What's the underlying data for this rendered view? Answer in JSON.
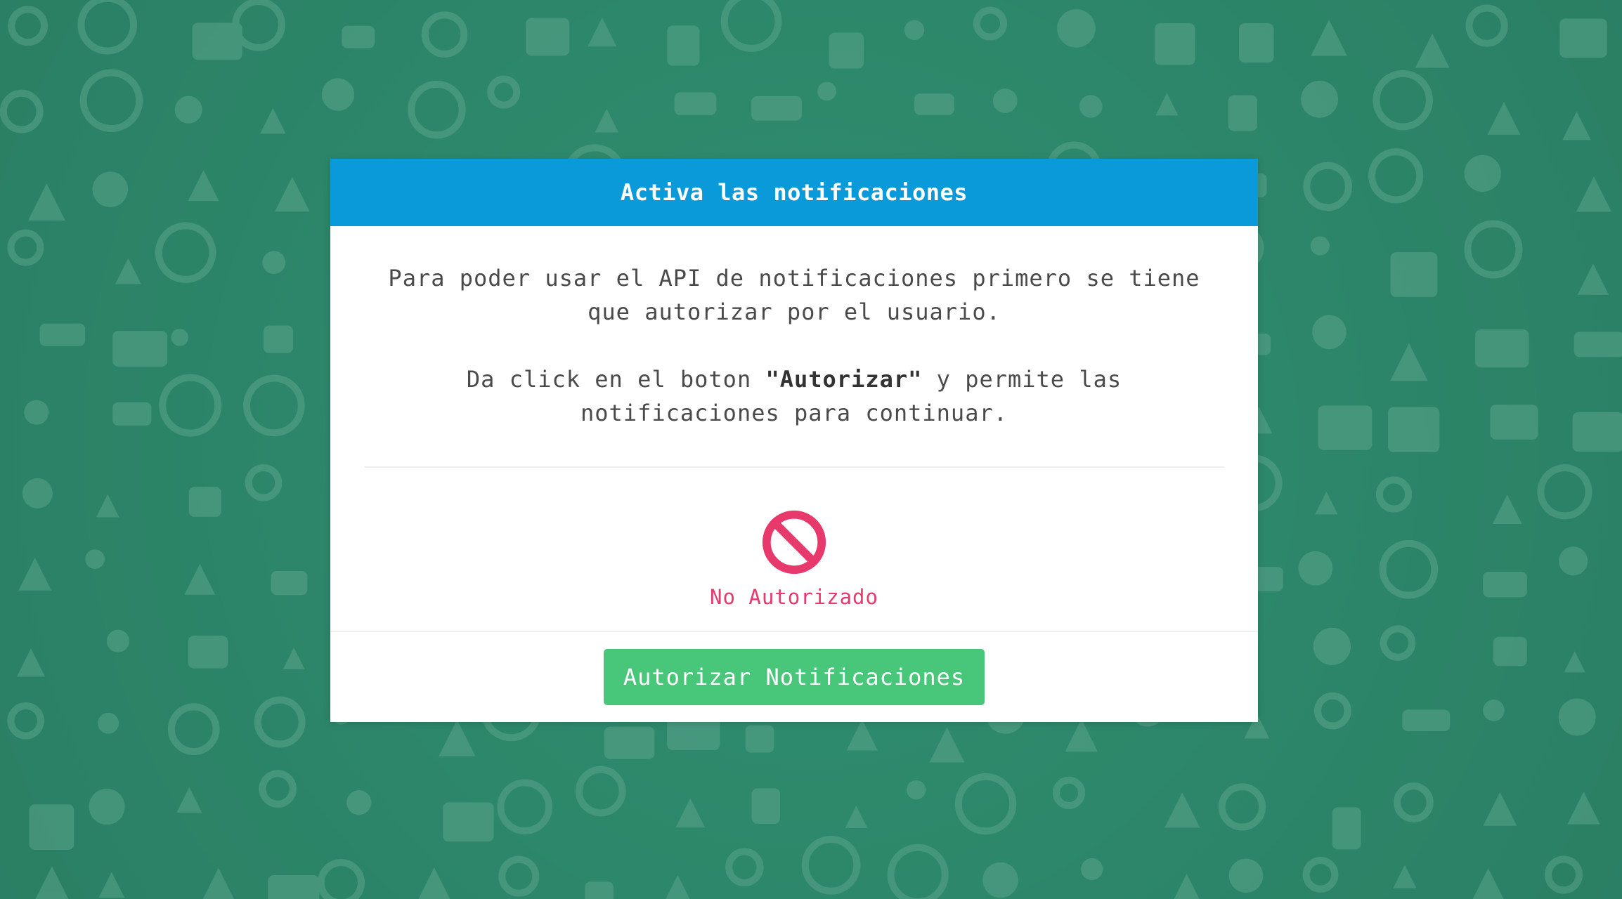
{
  "modal": {
    "title": "Activa las notificaciones",
    "paragraph1": "Para poder usar el API de notificaciones primero se tiene que autorizar por el usuario.",
    "paragraph2_before": "Da click en el boton ",
    "paragraph2_bold": "\"Autorizar\"",
    "paragraph2_after": " y permite las notificaciones para continuar.",
    "status": {
      "icon": "prohibited-icon",
      "text": "No Autorizado",
      "color": "#e8396d"
    },
    "button_label": "Autorizar Notificaciones"
  },
  "colors": {
    "header": "#0b9ad9",
    "button": "#48c77b",
    "background": "#2e8a6c"
  }
}
